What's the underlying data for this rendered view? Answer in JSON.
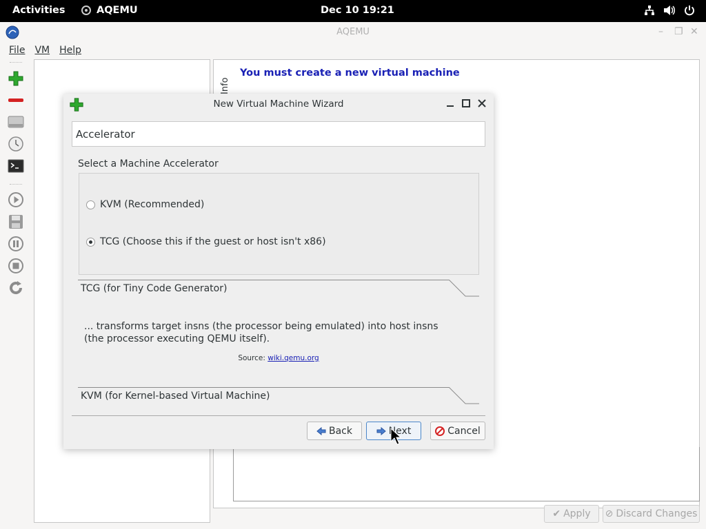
{
  "topbar": {
    "activities": "Activities",
    "app_name": "AQEMU",
    "clock": "Dec 10  19:21",
    "tray_icons": [
      "network-icon",
      "volume-icon",
      "power-icon"
    ]
  },
  "window": {
    "title": "AQEMU",
    "menu": [
      "File",
      "VM",
      "Help"
    ],
    "toolbar_icons": [
      "add-vm-icon",
      "remove-vm-icon",
      "hard-disk-icon",
      "clock-icon",
      "terminal-icon",
      "play-icon",
      "save-icon",
      "pause-icon",
      "stop-icon",
      "reload-icon"
    ],
    "info_tab": "Info",
    "info_heading": "You must create a new virtual machine",
    "apply_label": "Apply",
    "discard_label": "Discard Changes"
  },
  "dialog": {
    "title": "New Virtual Machine Wizard",
    "page_title": "Accelerator",
    "group_label": "Select a Machine Accelerator",
    "options": [
      {
        "label": "KVM (Recommended)",
        "checked": false
      },
      {
        "label": "TCG (Choose this if the guest or host isn't x86)",
        "checked": true
      }
    ],
    "tcg_heading": "TCG (for Tiny Code Generator)",
    "tcg_description": "... transforms target insns (the processor being emulated) into host insns (the processor executing QEMU itself).",
    "source_prefix": "Source:",
    "source_link": "wiki.qemu.org",
    "kvm_heading": "KVM (for Kernel-based Virtual Machine)",
    "back_label": "Back",
    "next_label": "Next",
    "cancel_label": "Cancel"
  },
  "colors": {
    "accent_blue": "#1a21b5",
    "add_green": "#2ea82e",
    "remove_red": "#d42222"
  }
}
